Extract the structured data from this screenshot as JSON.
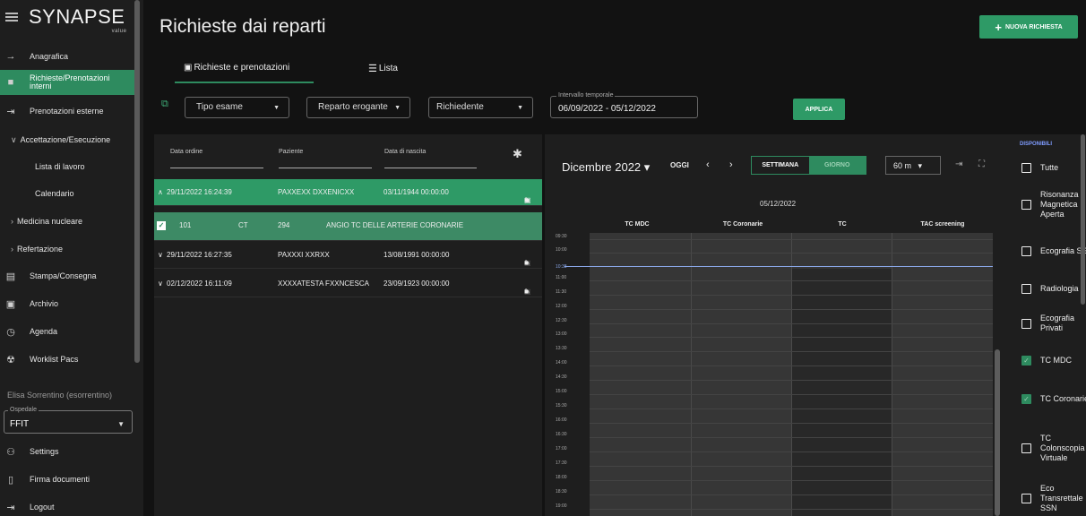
{
  "app": {
    "logo": "SYNAPSE",
    "logo_sub": "value"
  },
  "sidebar": {
    "items": [
      {
        "label": "Anagrafica",
        "icon": "arrow-right-icon"
      },
      {
        "label": "Richieste/Prenotazioni interni",
        "icon": "folder-icon",
        "active": true
      },
      {
        "label": "Prenotazioni esterne",
        "icon": "login-icon"
      },
      {
        "label": "Accettazione/Esecuzione",
        "icon": "chevron-down-icon",
        "group": true
      },
      {
        "label": "Lista di lavoro",
        "sub": true
      },
      {
        "label": "Calendario",
        "sub": true
      },
      {
        "label": "Medicina nucleare",
        "icon": "chevron-right-icon",
        "group": true
      },
      {
        "label": "Refertazione",
        "icon": "chevron-right-icon",
        "group": true
      },
      {
        "label": "Stampa/Consegna",
        "icon": "document-icon"
      },
      {
        "label": "Archivio",
        "icon": "archive-icon"
      },
      {
        "label": "Agenda",
        "icon": "clock-icon"
      },
      {
        "label": "Worklist Pacs",
        "icon": "radiation-icon"
      }
    ],
    "user": "Elisa Sorrentino (esorrentino)",
    "ospedale_label": "Ospedale",
    "ospedale_value": "FFIT",
    "footer": [
      {
        "label": "Settings",
        "icon": "user-settings-icon"
      },
      {
        "label": "Firma documenti",
        "icon": "clipboard-icon"
      },
      {
        "label": "Logout",
        "icon": "logout-icon"
      }
    ]
  },
  "header": {
    "title": "Richieste dai reparti",
    "new_button": "NUOVA RICHIESTA"
  },
  "tabs": [
    {
      "label": "Richieste e prenotazioni",
      "active": true
    },
    {
      "label": "Lista"
    }
  ],
  "filters": {
    "tipo_esame": "Tipo esame",
    "reparto": "Reparto erogante",
    "richiedente": "Richiedente",
    "interval_label": "Intervallo temporale",
    "interval_value": "06/09/2022 - 05/12/2022",
    "apply": "APPLICA"
  },
  "list": {
    "headers": [
      "Data ordine",
      "Paziente",
      "Data di nascita"
    ],
    "rows": [
      {
        "date": "29/11/2022 16:24:39",
        "patient": "PAXXEXX DXXENICXX",
        "birth": "03/11/1944 00:00:00",
        "expanded": true
      },
      {
        "date": "29/11/2022 16:27:35",
        "patient": "PAXXXI XXRXX",
        "birth": "13/08/1991 00:00:00"
      },
      {
        "date": "02/12/2022 16:11:09",
        "patient": "XXXXATESTA FXXNCESCA",
        "birth": "23/09/1923 00:00:00"
      }
    ],
    "detail": {
      "code": "101",
      "modality": "CT",
      "num": "294",
      "desc": "ANGIO TC DELLE ARTERIE CORONARIE"
    }
  },
  "calendar": {
    "month": "Dicembre 2022",
    "today": "OGGI",
    "week": "SETTIMANA",
    "day": "GIORNO",
    "slot": "60 m",
    "date": "05/12/2022",
    "resources": [
      "TC MDC",
      "TC Coronarie",
      "TC",
      "TAC screening"
    ],
    "times": [
      "09:30",
      "10:00",
      "10:38",
      "11:00",
      "11:30",
      "12:00",
      "12:30",
      "13:00",
      "13:30",
      "14:00",
      "14:30",
      "15:00",
      "15:30",
      "16:00",
      "16:30",
      "17:00",
      "17:30",
      "18:00",
      "18:30",
      "19:00"
    ]
  },
  "right_panel": {
    "label": "DISPONIBILI",
    "items": [
      {
        "label": "Tutte",
        "checked": false
      },
      {
        "label": "Risonanza Magnetica Aperta",
        "checked": false
      },
      {
        "label": "Ecografia SSN",
        "checked": false
      },
      {
        "label": "Radiologia",
        "checked": false
      },
      {
        "label": "Ecografia Privati",
        "checked": false
      },
      {
        "label": "TC MDC",
        "checked": true
      },
      {
        "label": "TC Coronarie",
        "checked": true
      },
      {
        "label": "TC Colonscopia Virtuale",
        "checked": false
      },
      {
        "label": "Eco Transrettale SSN",
        "checked": false
      }
    ]
  }
}
